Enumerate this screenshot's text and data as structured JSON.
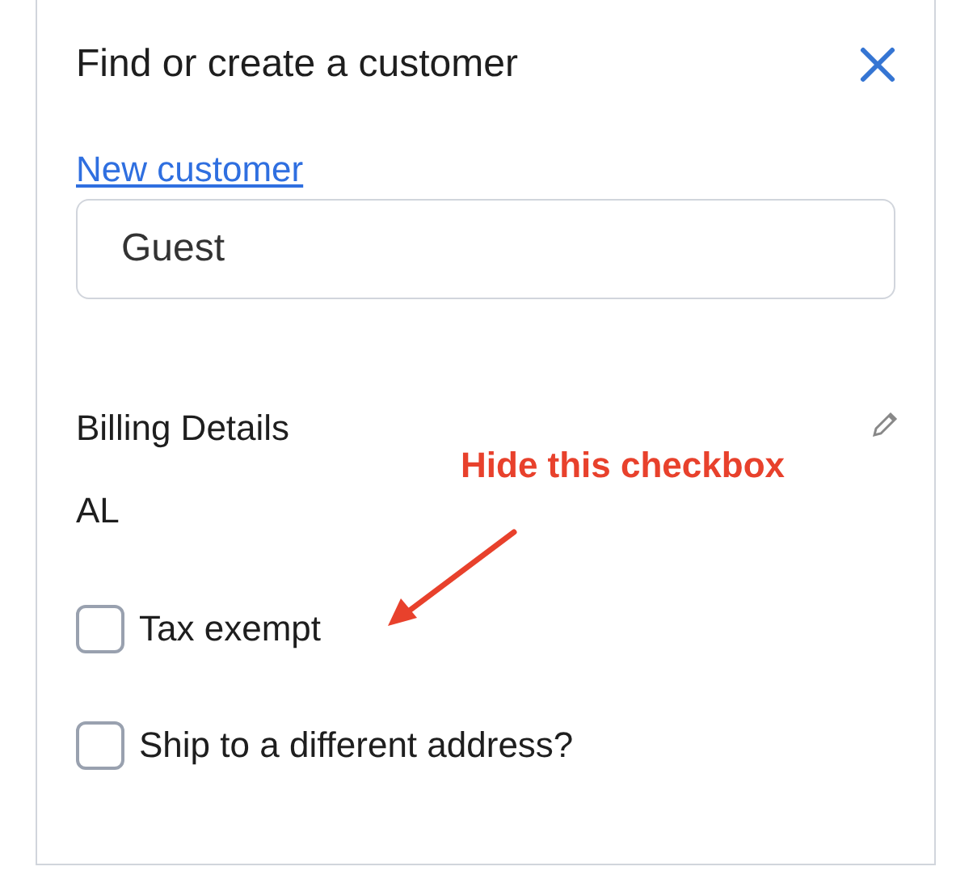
{
  "panel": {
    "title": "Find or create a customer"
  },
  "new_customer_link": "New customer",
  "customer_field": {
    "value": "Guest"
  },
  "billing": {
    "heading": "Billing Details",
    "value": "AL"
  },
  "annotation": {
    "text": "Hide this checkbox"
  },
  "checkboxes": [
    {
      "label": "Tax exempt",
      "checked": false
    },
    {
      "label": "Ship to a different address?",
      "checked": false
    }
  ]
}
